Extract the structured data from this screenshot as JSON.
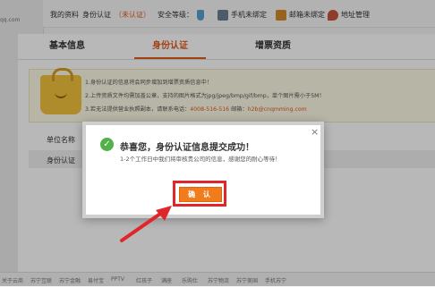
{
  "site": {
    "name": "qq.com"
  },
  "topbar": {
    "my_profile": "我的资料",
    "id_verify": "身份认证",
    "unverified": "（未认证）",
    "security_level": "安全等级：",
    "phone": "手机未绑定",
    "email": "邮箱未绑定",
    "address": "地址管理"
  },
  "tabs": [
    {
      "label": "基本信息"
    },
    {
      "label": "身份认证"
    },
    {
      "label": "增票资质"
    }
  ],
  "notice": {
    "line1": "1.身份认证的信息将会同步增加到增票资质信息中！",
    "line2": "2.上传资质文件均需加盖公章，支持的图片格式为jpg/jpeg/bmp/gif/bmp，单个图片需小于5M！",
    "line3_prefix": "3.若无法提供营业执照副本，请联系电话：",
    "phone": "4008-516-516",
    "line3_mid": " 邮箱：",
    "email": "h2b@cnqmming.com"
  },
  "form": {
    "company_name_label": "单位名称",
    "id_label": "身份认证"
  },
  "footer": {
    "links": [
      "关于云商",
      "苏宁互联",
      "苏宁金融",
      "易付宝",
      "PPTV",
      "红孩子",
      "满座",
      "乐购仕",
      "苏宁物流",
      "苏宁美国",
      "手机苏宁"
    ]
  },
  "dialog": {
    "close_symbol": "×",
    "check_symbol": "✓",
    "title": "恭喜您，身份认证信息提交成功！",
    "message": "1-2个工作日中我们将审核贵公司的信息，感谢您的耐心等待！",
    "confirm_label": "确 认"
  },
  "colors": {
    "accent": "#e25b1e",
    "confirm": "#f07c1d",
    "highlight_border": "#e0262a",
    "success": "#52b24a"
  }
}
